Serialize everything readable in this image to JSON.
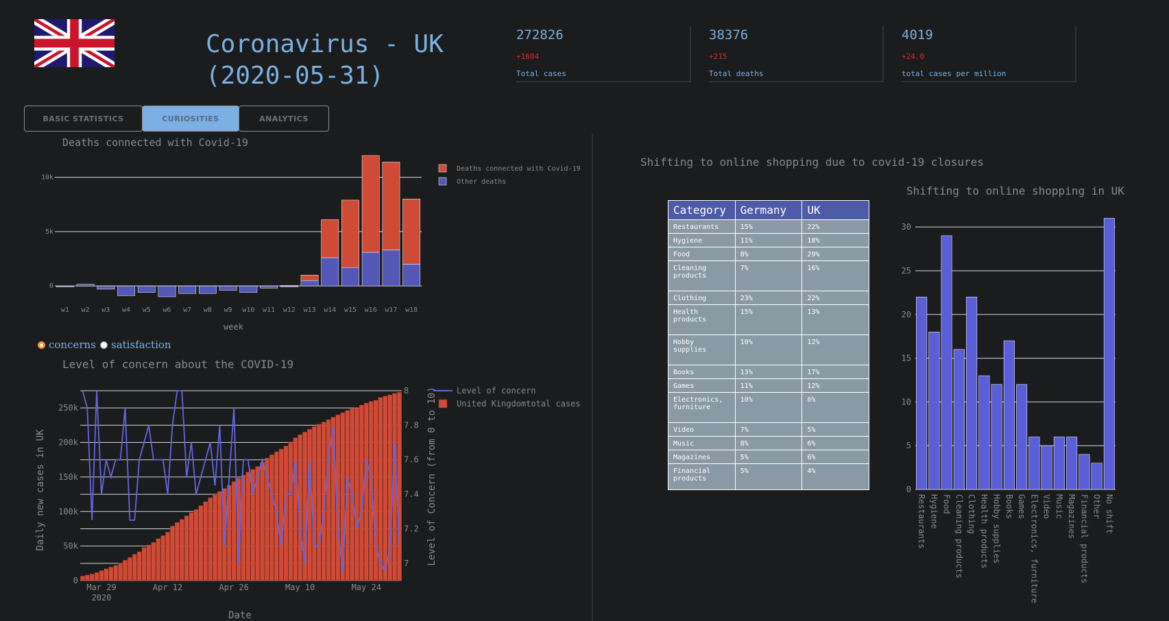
{
  "header": {
    "flag_icon": "uk-flag-icon",
    "title_line1": "Coronavirus - UK",
    "title_line2": "(2020-05-31)"
  },
  "stats": [
    {
      "value": "272826",
      "delta": "+1604",
      "label": "Total cases"
    },
    {
      "value": "38376",
      "delta": "+215",
      "label": "Total deaths"
    },
    {
      "value": "4019",
      "delta": "+24.0",
      "label": "total cases per million"
    }
  ],
  "tabs": [
    {
      "label": "BASIC STATISTICS",
      "active": false
    },
    {
      "label": "CURIOSITIES",
      "active": true
    },
    {
      "label": "ANALYTICS",
      "active": false
    }
  ],
  "colors": {
    "accent": "#7ab0e3",
    "covid_deaths": "#cf4b36",
    "other_deaths": "#5358b6",
    "delta": "#e8262c",
    "concern_line": "#6366e0",
    "shop_bar": "#5a5fd8"
  },
  "radio": {
    "concerns": "concerns",
    "satisfaction": "satisfaction",
    "selected": "concerns"
  },
  "right_panel": {
    "heading": "Shifting to online shopping due to covid-19 closures"
  },
  "table": {
    "headers": [
      "Category",
      "Germany",
      "UK"
    ],
    "rows": [
      [
        "Restaurants",
        "15%",
        "22%"
      ],
      [
        "Hygiene",
        "11%",
        "18%"
      ],
      [
        "Food",
        "8%",
        "29%"
      ],
      [
        "Cleaning products",
        "7%",
        "16%"
      ],
      [
        "Clothing",
        "23%",
        "22%"
      ],
      [
        "Health products",
        "15%",
        "13%"
      ],
      [
        "Hobby supplies",
        "10%",
        "12%"
      ],
      [
        "Books",
        "13%",
        "17%"
      ],
      [
        "Games",
        "11%",
        "12%"
      ],
      [
        "Electronics, furniture",
        "10%",
        "6%"
      ],
      [
        "Video",
        "7%",
        "5%"
      ],
      [
        "Music",
        "8%",
        "6%"
      ],
      [
        "Magazines",
        "5%",
        "6%"
      ],
      [
        "Financial products",
        "5%",
        "4%"
      ]
    ]
  },
  "chart_data": [
    {
      "type": "bar",
      "title": "Deaths connected with Covid-19",
      "xlabel": "week",
      "ylabel": "",
      "categories": [
        "w1",
        "w2",
        "w3",
        "w4",
        "w5",
        "w6",
        "w7",
        "w8",
        "w9",
        "w10",
        "w11",
        "w12",
        "w13",
        "w14",
        "w15",
        "w16",
        "w17",
        "w18"
      ],
      "ylim": [
        -1000,
        12500
      ],
      "yticks": [
        {
          "v": 0,
          "label": "0"
        },
        {
          "v": 5000,
          "label": "5k"
        },
        {
          "v": 10000,
          "label": "10k"
        }
      ],
      "legend_position": "right",
      "series": [
        {
          "name": "Other deaths",
          "values": [
            -100,
            150,
            -300,
            -900,
            -600,
            -1000,
            -700,
            -700,
            -400,
            -600,
            -200,
            -100,
            500,
            2600,
            1700,
            3100,
            3300,
            2000
          ]
        },
        {
          "name": "Deaths connected with Covid-19",
          "values": [
            0,
            0,
            0,
            0,
            0,
            0,
            0,
            0,
            0,
            0,
            0,
            50,
            500,
            3500,
            6200,
            8900,
            8100,
            6000
          ]
        }
      ],
      "grid": true
    },
    {
      "type": "bar+line",
      "title": "Level of concern about the COVID-19",
      "xlabel": "Date",
      "ylabel": "Daily new cases in UK",
      "y2label": "Level of Concern (from 0 to 10)",
      "ylim": [
        0,
        275000
      ],
      "y2lim": [
        6.9,
        8.0
      ],
      "yticks": [
        {
          "v": 0,
          "label": "0"
        },
        {
          "v": 50000,
          "label": "50k"
        },
        {
          "v": 100000,
          "label": "100k"
        },
        {
          "v": 150000,
          "label": "150k"
        },
        {
          "v": 200000,
          "label": "200k"
        },
        {
          "v": 250000,
          "label": "250k"
        }
      ],
      "y2ticks": [
        {
          "v": 7.0,
          "label": "7"
        },
        {
          "v": 7.2,
          "label": "7.2"
        },
        {
          "v": 7.4,
          "label": "7.4"
        },
        {
          "v": 7.6,
          "label": "7.6"
        },
        {
          "v": 7.8,
          "label": "7.8"
        },
        {
          "v": 8.0,
          "label": "8"
        }
      ],
      "xticks": [
        {
          "i": 4,
          "label": "Mar 29"
        },
        {
          "i": 18,
          "label": "Apr 12"
        },
        {
          "i": 32,
          "label": "Apr 26"
        },
        {
          "i": 46,
          "label": "May 10"
        },
        {
          "i": 60,
          "label": "May 24"
        }
      ],
      "xyear": {
        "i": 4,
        "label": "2020"
      },
      "x_start": "2020-03-25",
      "x_end": "2020-05-31",
      "legend_position": "right",
      "series": [
        {
          "name": "United Kingdomtotal cases",
          "kind": "bar",
          "values": [
            6650,
            8077,
            9529,
            11658,
            14543,
            17089,
            19522,
            22141,
            25150,
            29474,
            33718,
            38168,
            41903,
            47806,
            51608,
            55242,
            60733,
            65077,
            70272,
            78991,
            84279,
            88621,
            93873,
            98476,
            103093,
            108692,
            114217,
            120067,
            124743,
            129044,
            133495,
            138078,
            143464,
            148377,
            152840,
            157149,
            161145,
            165221,
            171253,
            177454,
            182260,
            186599,
            190584,
            194990,
            201101,
            206715,
            211364,
            215260,
            219183,
            223060,
            226463,
            229705,
            233151,
            236711,
            240161,
            243303,
            246406,
            248818,
            250908,
            254195,
            257154,
            259559,
            261184,
            265227,
            267240,
            269127,
            271222,
            272826
          ]
        },
        {
          "name": "Level of concern",
          "kind": "line",
          "values": [
            8.0,
            7.9,
            7.25,
            8.0,
            7.4,
            7.6,
            7.5,
            7.6,
            7.6,
            7.9,
            7.25,
            7.25,
            7.6,
            7.7,
            7.8,
            7.6,
            7.6,
            7.6,
            7.4,
            7.8,
            8.0,
            8.0,
            7.5,
            7.7,
            7.4,
            7.5,
            7.6,
            7.7,
            7.45,
            7.8,
            7.1,
            7.5,
            7.9,
            7.0,
            7.6,
            7.6,
            7.4,
            7.5,
            7.6,
            7.5,
            7.4,
            7.3,
            7.1,
            7.4,
            7.4,
            7.6,
            7.2,
            7.0,
            7.6,
            7.1,
            7.1,
            7.3,
            7.6,
            7.8,
            7.2,
            6.95,
            7.5,
            7.4,
            7.2,
            7.3,
            7.6,
            7.5,
            7.1,
            7.0,
            6.95,
            7.1,
            7.7,
            7.1
          ]
        }
      ],
      "grid": true
    },
    {
      "type": "bar",
      "title": "Shifting to online shopping in UK",
      "xlabel": "",
      "ylabel": "",
      "categories": [
        "Restaurants",
        "Hygiene",
        "Food",
        "Cleaning products",
        "Clothing",
        "Health products",
        "Hobby supplies",
        "Books",
        "Games",
        "Electronics, furniture",
        "Video",
        "Music",
        "Magazines",
        "Financial products",
        "Other",
        "No shift"
      ],
      "values": [
        22,
        18,
        29,
        16,
        22,
        13,
        12,
        17,
        12,
        6,
        5,
        6,
        6,
        4,
        3,
        31
      ],
      "ylim": [
        0,
        31.5
      ],
      "yticks": [
        0,
        5,
        10,
        15,
        20,
        25,
        30
      ],
      "grid": true
    }
  ]
}
